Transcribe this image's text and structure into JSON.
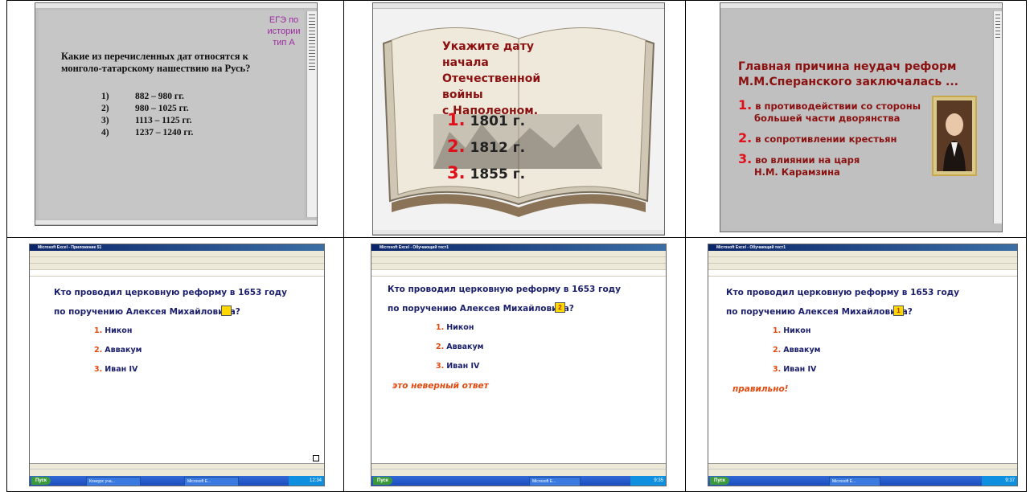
{
  "panel1": {
    "tag_line1": "ЕГЭ по истории",
    "tag_line2": "тип А",
    "question_line1": "Какие из перечисленных дат относятся к",
    "question_line2": "монголо-татарскому нашествию на Русь?",
    "options": [
      {
        "n": "1)",
        "text": "882 – 980 гг."
      },
      {
        "n": "2)",
        "text": "980 – 1025 гг."
      },
      {
        "n": "3)",
        "text": "1113 – 1125 гг."
      },
      {
        "n": "4)",
        "text": "1237 – 1240 гг."
      }
    ]
  },
  "panel2": {
    "question_line1": "Укажите дату начала",
    "question_line2": "Отечественной войны",
    "question_line3": "с Наполеоном.",
    "options": [
      {
        "n": "1.",
        "text": "1801 г."
      },
      {
        "n": "2.",
        "text": "1812 г."
      },
      {
        "n": "3.",
        "text": "1855 г."
      }
    ]
  },
  "panel3": {
    "heading_line1": "Главная причина неудач реформ",
    "heading_line2": "М.М.Сперанского заключалась ...",
    "options": [
      {
        "n": "1.",
        "line1": "в противодействии со стороны",
        "line2": "большей части дворянства"
      },
      {
        "n": "2.",
        "line1": "в сопротивлении крестьян",
        "line2": ""
      },
      {
        "n": "3.",
        "line1": "во влиянии на царя",
        "line2": "Н.М. Карамзина"
      }
    ]
  },
  "excel": {
    "question_line1": "Кто проводил церковную реформу в 1653 году",
    "question_line2": "по поручению Алексея Михайловича?",
    "options": [
      {
        "n": "1.",
        "text": "Никон"
      },
      {
        "n": "2.",
        "text": "Аввакум"
      },
      {
        "n": "3.",
        "text": "Иван IV"
      }
    ],
    "panel4": {
      "title": "Microsoft Excel - Приложение 51",
      "answer": "",
      "feedback": "",
      "clock": "12:34"
    },
    "panel5": {
      "title": "Microsoft Excel - Обучающий тест1",
      "answer": "2",
      "feedback": "это неверный ответ",
      "clock": "9:35"
    },
    "panel6": {
      "title": "Microsoft Excel - Обучающий тест1",
      "answer": "1",
      "feedback": "правильно!",
      "clock": "9:37"
    },
    "taskbar": {
      "start": "Пуск",
      "task1": "Конкурс уча...",
      "task2": "Microsoft E..."
    }
  },
  "colors": {
    "question_blue": "#1b1f6b",
    "accent_orange": "#e24a10",
    "slide_red": "#8b1010",
    "number_red": "#e0101a",
    "highlight_yellow": "#ffd800"
  }
}
